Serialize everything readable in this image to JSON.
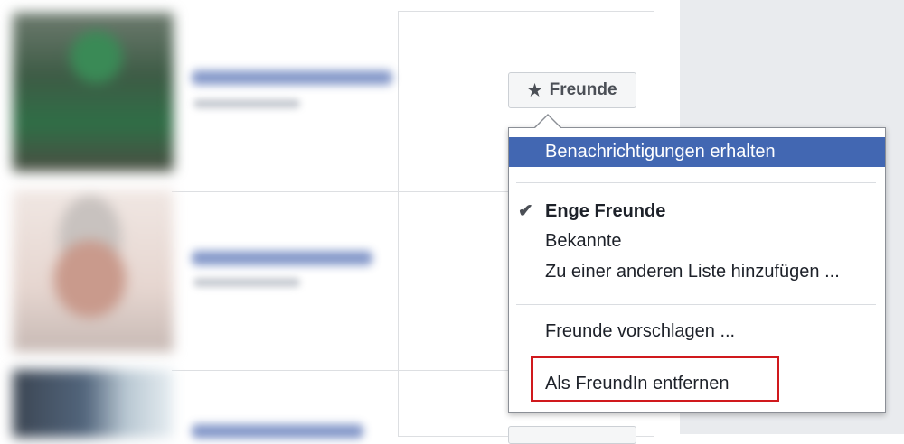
{
  "friend_card": {
    "button_label": "Freunde",
    "button_icon": "star-icon"
  },
  "dropdown": {
    "items": [
      {
        "label": "Benachrichtigungen erhalten",
        "highlighted": true
      },
      {
        "label": "Enge Freunde",
        "checked": true
      },
      {
        "label": "Bekannte"
      },
      {
        "label": "Zu einer anderen Liste hinzufügen ..."
      },
      {
        "label": "Freunde vorschlagen ..."
      },
      {
        "label": "Als FreundIn entfernen",
        "emphasized_box": true
      }
    ],
    "check_glyph": "✔"
  },
  "colors": {
    "highlight": "#4267b2",
    "annotation_box": "#d0191d",
    "page_gray": "#e9ebee"
  }
}
